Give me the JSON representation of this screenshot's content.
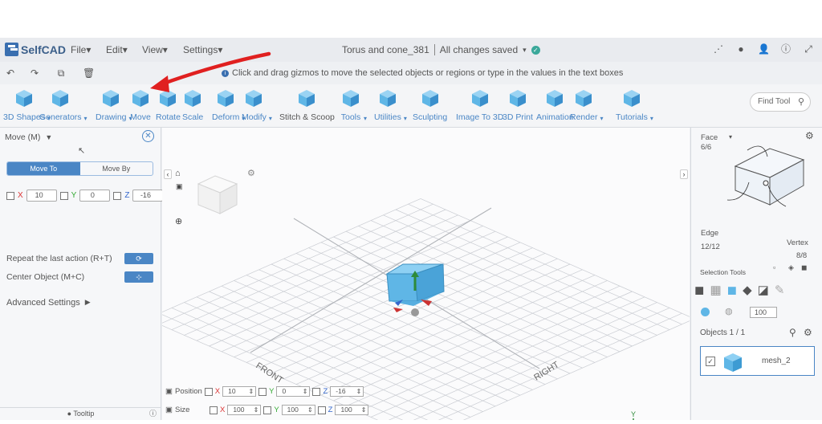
{
  "app": {
    "name": "SelfCAD",
    "doc_title": "Torus and cone_381",
    "save_status": "All changes saved"
  },
  "menu": [
    "File",
    "Edit",
    "View",
    "Settings"
  ],
  "hint": "Click and drag gizmos to move the selected objects or regions or type in the values in the text boxes",
  "tools": [
    {
      "label": "3D Shapes",
      "arrow": true
    },
    {
      "label": "Generators",
      "arrow": true
    },
    {
      "label": "Drawing",
      "arrow": true
    },
    {
      "label": "Move",
      "arrow": false
    },
    {
      "label": "Rotate",
      "arrow": false
    },
    {
      "label": "Scale",
      "arrow": false
    },
    {
      "label": "Deform",
      "arrow": true
    },
    {
      "label": "Modify",
      "arrow": true
    },
    {
      "label": "Stitch & Scoop",
      "arrow": false
    },
    {
      "label": "Tools",
      "arrow": true
    },
    {
      "label": "Utilities",
      "arrow": true
    },
    {
      "label": "Sculpting",
      "arrow": false
    },
    {
      "label": "Image To 3D",
      "arrow": false
    },
    {
      "label": "3D Print",
      "arrow": false
    },
    {
      "label": "Animation",
      "arrow": false
    },
    {
      "label": "Render",
      "arrow": true
    },
    {
      "label": "Tutorials",
      "arrow": true
    }
  ],
  "find_tool": "Find Tool",
  "panel": {
    "title": "Move (M)",
    "seg_a": "Move To",
    "seg_b": "Move By",
    "x": "10",
    "y": "0",
    "z": "-16",
    "repeat": "Repeat the last action (R+T)",
    "center": "Center Object (M+C)",
    "advanced": "Advanced Settings",
    "tooltip": "Tooltip"
  },
  "viewport": {
    "front": "FRONT",
    "right": "RIGHT"
  },
  "bottom": {
    "position_label": "Position",
    "size_label": "Size",
    "pos": {
      "x": "10",
      "y": "0",
      "z": "-16"
    },
    "size": {
      "x": "100",
      "y": "100",
      "z": "100"
    }
  },
  "right": {
    "face": "Face",
    "face_count": "6/6",
    "edge": "Edge",
    "edge_count": "12/12",
    "vertex": "Vertex",
    "vertex_count": "8/8",
    "selection_tools": "Selection Tools",
    "opacity": "100",
    "objects": "Objects 1 / 1",
    "object_name": "mesh_2"
  },
  "colors": {
    "accent": "#4a86c5",
    "cube": "#5fb6e6",
    "annotation_arrow": "#e02020"
  }
}
